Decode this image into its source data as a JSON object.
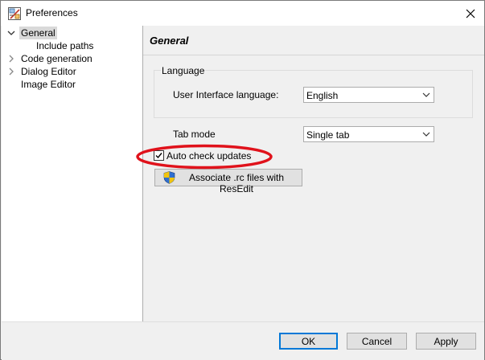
{
  "window": {
    "title": "Preferences",
    "icon": "app-preferences-icon"
  },
  "tree": {
    "items": [
      {
        "label": "General",
        "expanded": true,
        "selected": true
      },
      {
        "label": "Include paths",
        "child": true
      },
      {
        "label": "Code generation",
        "expanded": false
      },
      {
        "label": "Dialog Editor",
        "expanded": false
      },
      {
        "label": "Image Editor"
      }
    ]
  },
  "content": {
    "title": "General",
    "language_group": {
      "legend": "Language",
      "ui_language_label": "User Interface language:",
      "ui_language_value": "English"
    },
    "tab_mode": {
      "label": "Tab mode",
      "value": "Single tab"
    },
    "auto_check": {
      "label": "Auto check updates",
      "checked": true
    },
    "associate_button": {
      "label": "Associate .rc files with ResEdit",
      "icon": "shield-icon"
    }
  },
  "footer": {
    "ok": "OK",
    "cancel": "Cancel",
    "apply": "Apply"
  },
  "colors": {
    "annotation": "#e0121b",
    "accent": "#0078d7"
  }
}
